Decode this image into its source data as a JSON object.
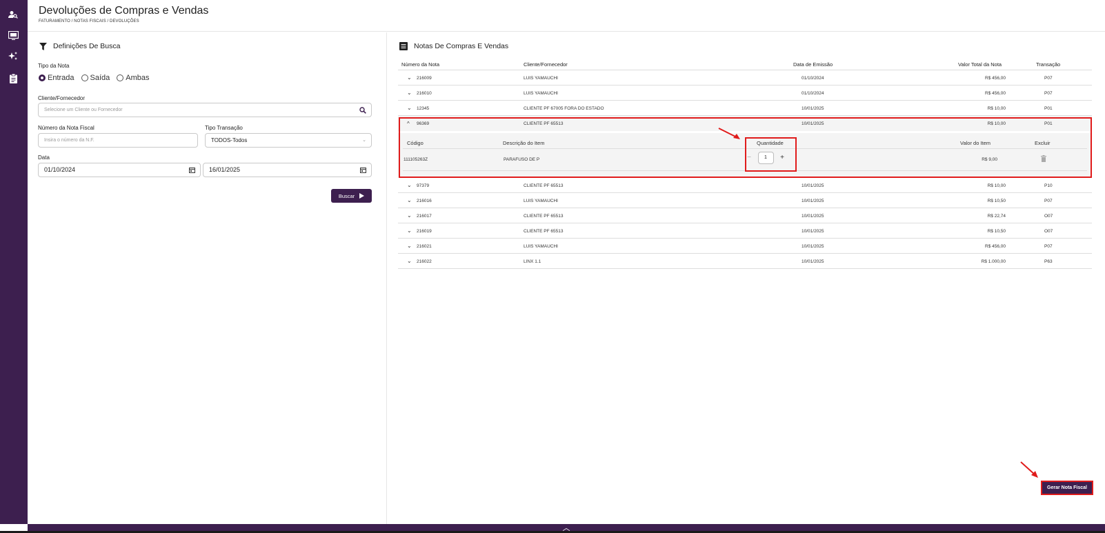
{
  "header": {
    "title": "Devoluções de Compras e Vendas",
    "breadcrumb": "FATURAMENTO / NOTAS FISCAIS / DEVOLUÇÕES"
  },
  "sidebar": {
    "icons": [
      "users-search-icon",
      "monitor-icon",
      "sparkles-icon",
      "clipboard-icon"
    ]
  },
  "search": {
    "title": "Definições De Busca",
    "tipo_nota_label": "Tipo da Nota",
    "radio_options": [
      "Entrada",
      "Saída",
      "Ambas"
    ],
    "radio_selected": "Entrada",
    "cliente_label": "Cliente/Fornecedor",
    "cliente_placeholder": "Selecione um Cliente ou Fornecedor",
    "numero_label": "Número da Nota Fiscal",
    "numero_placeholder": "Insira o número da N.F.",
    "tipo_transacao_label": "Tipo Transação",
    "tipo_transacao_value": "TODOS-Todos",
    "data_label": "Data",
    "data_inicio": "01/10/2024",
    "data_fim": "16/01/2025",
    "buscar_label": "Buscar"
  },
  "notes": {
    "title": "Notas De Compras E Vendas",
    "columns": [
      "Número da Nota",
      "Cliente/Fornecedor",
      "Data de Emissão",
      "Valor Total da Nota",
      "Transação"
    ],
    "rows": [
      {
        "numero": "216009",
        "cliente": "LUIS YAMAUCHI",
        "data": "01/10/2024",
        "valor": "R$ 456,00",
        "transacao": "P07"
      },
      {
        "numero": "216010",
        "cliente": "LUIS YAMAUCHI",
        "data": "01/10/2024",
        "valor": "R$ 456,00",
        "transacao": "P07"
      },
      {
        "numero": "12345",
        "cliente": "CLIENTE PF 67005 FORA DO ESTADO",
        "data": "10/01/2025",
        "valor": "R$ 10,00",
        "transacao": "P01"
      },
      {
        "numero": "96369",
        "cliente": "CLIENTE PF 65513",
        "data": "10/01/2025",
        "valor": "R$ 10,00",
        "transacao": "P01"
      },
      {
        "numero": "97379",
        "cliente": "CLIENTE PF 65513",
        "data": "10/01/2025",
        "valor": "R$ 10,00",
        "transacao": "P10"
      },
      {
        "numero": "216016",
        "cliente": "LUIS YAMAUCHI",
        "data": "10/01/2025",
        "valor": "R$ 10,50",
        "transacao": "P07"
      },
      {
        "numero": "216017",
        "cliente": "CLIENTE PF 65513",
        "data": "10/01/2025",
        "valor": "R$ 22,74",
        "transacao": "O07"
      },
      {
        "numero": "216019",
        "cliente": "CLIENTE PF 65513",
        "data": "10/01/2025",
        "valor": "R$ 10,50",
        "transacao": "O07"
      },
      {
        "numero": "216021",
        "cliente": "LUIS YAMAUCHI",
        "data": "10/01/2025",
        "valor": "R$ 456,00",
        "transacao": "P07"
      },
      {
        "numero": "216022",
        "cliente": "LINX 1.1",
        "data": "10/01/2025",
        "valor": "R$ 1.000,00",
        "transacao": "P63"
      }
    ],
    "expanded": {
      "columns": [
        "Código",
        "Descrição do Item",
        "Quantidade",
        "Valor do Item",
        "Excluir"
      ],
      "item": {
        "codigo": "111105263Z",
        "descricao": "PARAFUSO DE P",
        "quantidade": "1",
        "valor": "R$ 9,00"
      }
    }
  },
  "gerar_label": "Gerar Nota Fiscal",
  "colors": {
    "brand": "#3d1f4f",
    "highlight": "#e01b1b"
  }
}
